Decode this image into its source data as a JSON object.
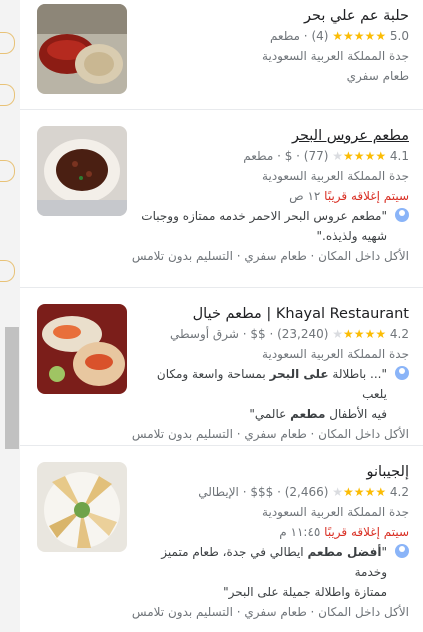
{
  "results": [
    {
      "title": "حلبة عم علي بحر",
      "rating": "5.0",
      "reviews": "(4)",
      "price": "",
      "category": "مطعم",
      "location": "جدة المملكة العربية السعودية",
      "extra": "طعام سفري"
    },
    {
      "title": "مطعم عروس البحر",
      "rating": "4.1",
      "reviews": "(77)",
      "price": "$",
      "category": "مطعم",
      "location": "جدة المملكة العربية السعودية",
      "status": "سيتم إغلاقه قريبًا",
      "status_time": "١٢ ص",
      "quote_line1": "\"مطعم عروس البحر الاحمر خدمه ممتازه ووجبات",
      "quote_line2": "شهيه ولذيذه.\"",
      "services": "الأكل داخل المكان · طعام سفري · التسليم بدون تلامس"
    },
    {
      "title": "Khayal Restaurant | مطعم خيال",
      "rating": "4.2",
      "reviews": "(23,240)",
      "price": "$$",
      "category": "شرق أوسطي",
      "location": "جدة المملكة العربية السعودية",
      "quote_line1_pre": "\"... باطلالة ",
      "quote_line1_bold": "على البحر",
      "quote_line1_post": " بمساحة واسعة ومكان يلعب",
      "quote_line2_pre": "فيه الأطفال ",
      "quote_line2_bold": "مطعم",
      "quote_line2_post": " عالمي\"",
      "services": "الأكل داخل المكان · طعام سفري · التسليم بدون تلامس"
    },
    {
      "title": "إلجيبانو",
      "rating": "4.2",
      "reviews": "(2,466)",
      "price": "$$$",
      "category": "الإيطالي",
      "location": "جدة المملكة العربية السعودية",
      "status": "سيتم إغلاقه قريبًا",
      "status_time": "١١:٤٥ م",
      "quote_line1_pre": "\"",
      "quote_line1_bold": "أفضل مطعم",
      "quote_line1_post": " ايطالي في جدة، طعام متميز وخدمة",
      "quote_line2": "ممتازة واطلالة جميلة على البحر\"",
      "services": "الأكل داخل المكان · طعام سفري · التسليم بدون تلامس"
    }
  ],
  "colors": {
    "star": "#fbbc04",
    "closing": "#d93025",
    "muted": "#70757a"
  },
  "icons": {
    "star": "star-icon",
    "avatar": "reviewer-avatar-icon"
  }
}
